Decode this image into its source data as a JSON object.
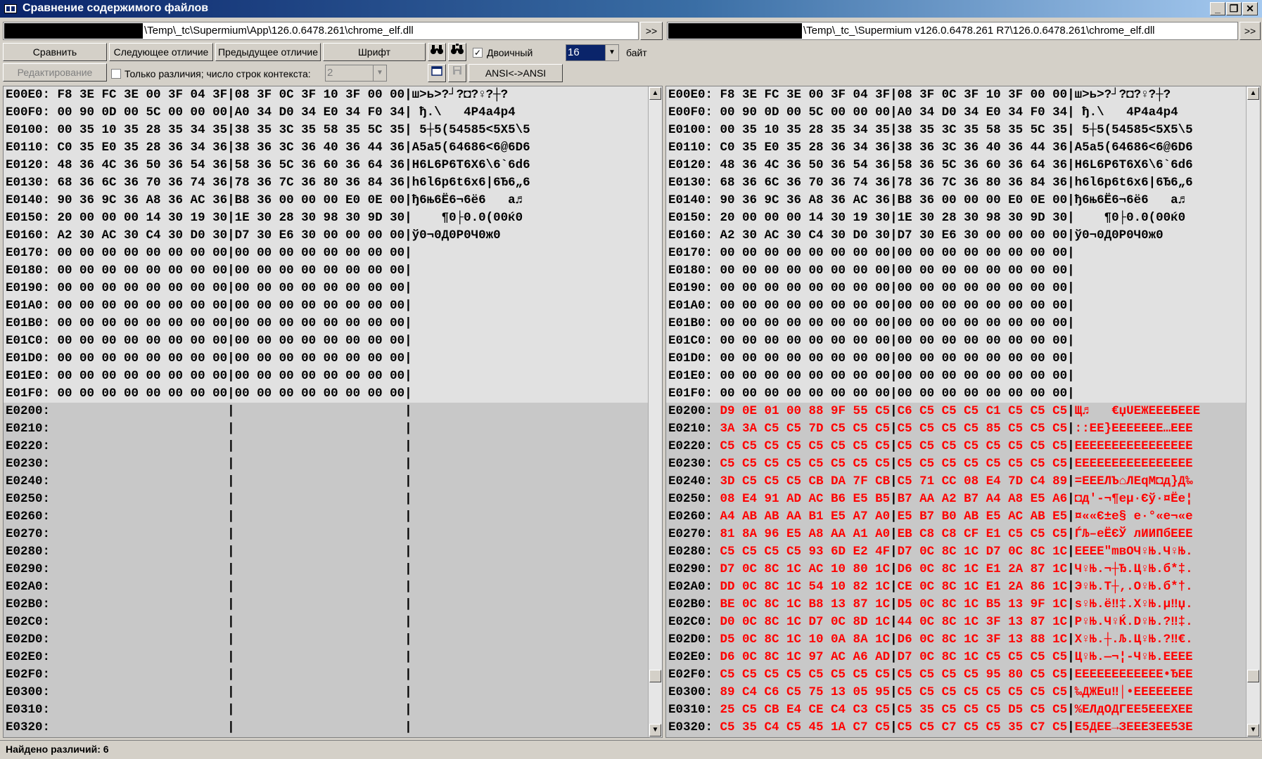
{
  "window": {
    "title": "Сравнение содержимого файлов"
  },
  "left_path": "\\Temp\\_tc\\Supermium\\App\\126.0.6478.261\\chrome_elf.dll",
  "right_path": "\\Temp\\_tc_\\Supermium v126.0.6478.261 R7\\126.0.6478.261\\chrome_elf.dll",
  "nav_label": ">>",
  "toolbar": {
    "compare": "Сравнить",
    "next_diff": "Следующее отличие",
    "prev_diff": "Предыдущее отличие",
    "font": "Шрифт",
    "binary_label": "Двоичный",
    "binary_checked": "✓",
    "bytes_value": "16",
    "bytes_label": "байт",
    "edit": "Редактирование",
    "only_diffs_label": "Только различия; число строк контекста:",
    "context_value": "2",
    "ansi": "ANSI<->ANSI"
  },
  "left_rows": [
    {
      "addr": "E00E0:",
      "hex1": "F8 3E FC 3E 00 3F 04 3F",
      "hex2": "08 3F 0C 3F 10 3F 00 00",
      "text": "ш>ь>?┘?◘?♀?┼?",
      "state": "same"
    },
    {
      "addr": "E00F0:",
      "hex1": "00 90 0D 00 5C 00 00 00",
      "hex2": "A0 34 D0 34 E0 34 F0 34",
      "text": " ђ.\\   4P4a4p4",
      "state": "same"
    },
    {
      "addr": "E0100:",
      "hex1": "00 35 10 35 28 35 34 35",
      "hex2": "38 35 3C 35 58 35 5C 35",
      "text": " 5┼5(54585<5X5\\5",
      "state": "same"
    },
    {
      "addr": "E0110:",
      "hex1": "C0 35 E0 35 28 36 34 36",
      "hex2": "38 36 3C 36 40 36 44 36",
      "text": "A5a5(64686<6@6D6",
      "state": "same"
    },
    {
      "addr": "E0120:",
      "hex1": "48 36 4C 36 50 36 54 36",
      "hex2": "58 36 5C 36 60 36 64 36",
      "text": "H6L6P6T6X6\\6`6d6",
      "state": "same"
    },
    {
      "addr": "E0130:",
      "hex1": "68 36 6C 36 70 36 74 36",
      "hex2": "78 36 7C 36 80 36 84 36",
      "text": "h6l6p6t6x6|6Ђ6„6",
      "state": "same"
    },
    {
      "addr": "E0140:",
      "hex1": "90 36 9C 36 A8 36 AC 36",
      "hex2": "B8 36 00 00 00 E0 0E 00",
      "text": "ђ6њ6Ё6¬6ё6   а♬",
      "state": "same"
    },
    {
      "addr": "E0150:",
      "hex1": "20 00 00 00 14 30 19 30",
      "hex2": "1E 30 28 30 98 30 9D 30",
      "text": "    ¶0├0.0(00ќ0",
      "state": "same"
    },
    {
      "addr": "E0160:",
      "hex1": "A2 30 AC 30 C4 30 D0 30",
      "hex2": "D7 30 E6 30 00 00 00 00",
      "text": "ў0¬0Д0Р0Ч0ж0",
      "state": "same"
    },
    {
      "addr": "E0170:",
      "hex1": "00 00 00 00 00 00 00 00",
      "hex2": "00 00 00 00 00 00 00 00",
      "text": "",
      "state": "same"
    },
    {
      "addr": "E0180:",
      "hex1": "00 00 00 00 00 00 00 00",
      "hex2": "00 00 00 00 00 00 00 00",
      "text": "",
      "state": "same"
    },
    {
      "addr": "E0190:",
      "hex1": "00 00 00 00 00 00 00 00",
      "hex2": "00 00 00 00 00 00 00 00",
      "text": "",
      "state": "same"
    },
    {
      "addr": "E01A0:",
      "hex1": "00 00 00 00 00 00 00 00",
      "hex2": "00 00 00 00 00 00 00 00",
      "text": "",
      "state": "same"
    },
    {
      "addr": "E01B0:",
      "hex1": "00 00 00 00 00 00 00 00",
      "hex2": "00 00 00 00 00 00 00 00",
      "text": "",
      "state": "same"
    },
    {
      "addr": "E01C0:",
      "hex1": "00 00 00 00 00 00 00 00",
      "hex2": "00 00 00 00 00 00 00 00",
      "text": "",
      "state": "same"
    },
    {
      "addr": "E01D0:",
      "hex1": "00 00 00 00 00 00 00 00",
      "hex2": "00 00 00 00 00 00 00 00",
      "text": "",
      "state": "same"
    },
    {
      "addr": "E01E0:",
      "hex1": "00 00 00 00 00 00 00 00",
      "hex2": "00 00 00 00 00 00 00 00",
      "text": "",
      "state": "same"
    },
    {
      "addr": "E01F0:",
      "hex1": "00 00 00 00 00 00 00 00",
      "hex2": "00 00 00 00 00 00 00 00",
      "text": "",
      "state": "same"
    },
    {
      "addr": "E0200:",
      "hex1": "",
      "hex2": "",
      "text": "",
      "state": "blank"
    },
    {
      "addr": "E0210:",
      "hex1": "",
      "hex2": "",
      "text": "",
      "state": "blank"
    },
    {
      "addr": "E0220:",
      "hex1": "",
      "hex2": "",
      "text": "",
      "state": "blank"
    },
    {
      "addr": "E0230:",
      "hex1": "",
      "hex2": "",
      "text": "",
      "state": "blank"
    },
    {
      "addr": "E0240:",
      "hex1": "",
      "hex2": "",
      "text": "",
      "state": "blank"
    },
    {
      "addr": "E0250:",
      "hex1": "",
      "hex2": "",
      "text": "",
      "state": "blank"
    },
    {
      "addr": "E0260:",
      "hex1": "",
      "hex2": "",
      "text": "",
      "state": "blank"
    },
    {
      "addr": "E0270:",
      "hex1": "",
      "hex2": "",
      "text": "",
      "state": "blank"
    },
    {
      "addr": "E0280:",
      "hex1": "",
      "hex2": "",
      "text": "",
      "state": "blank"
    },
    {
      "addr": "E0290:",
      "hex1": "",
      "hex2": "",
      "text": "",
      "state": "blank"
    },
    {
      "addr": "E02A0:",
      "hex1": "",
      "hex2": "",
      "text": "",
      "state": "blank"
    },
    {
      "addr": "E02B0:",
      "hex1": "",
      "hex2": "",
      "text": "",
      "state": "blank"
    },
    {
      "addr": "E02C0:",
      "hex1": "",
      "hex2": "",
      "text": "",
      "state": "blank"
    },
    {
      "addr": "E02D0:",
      "hex1": "",
      "hex2": "",
      "text": "",
      "state": "blank"
    },
    {
      "addr": "E02E0:",
      "hex1": "",
      "hex2": "",
      "text": "",
      "state": "blank"
    },
    {
      "addr": "E02F0:",
      "hex1": "",
      "hex2": "",
      "text": "",
      "state": "blank"
    },
    {
      "addr": "E0300:",
      "hex1": "",
      "hex2": "",
      "text": "",
      "state": "blank"
    },
    {
      "addr": "E0310:",
      "hex1": "",
      "hex2": "",
      "text": "",
      "state": "blank"
    },
    {
      "addr": "E0320:",
      "hex1": "",
      "hex2": "",
      "text": "",
      "state": "blank"
    }
  ],
  "right_rows": [
    {
      "addr": "E00E0:",
      "hex1": "F8 3E FC 3E 00 3F 04 3F",
      "hex2": "08 3F 0C 3F 10 3F 00 00",
      "text": "ш>ь>?┘?◘?♀?┼?",
      "state": "same"
    },
    {
      "addr": "E00F0:",
      "hex1": "00 90 0D 00 5C 00 00 00",
      "hex2": "A0 34 D0 34 E0 34 F0 34",
      "text": " ђ.\\   4P4a4p4",
      "state": "same"
    },
    {
      "addr": "E0100:",
      "hex1": "00 35 10 35 28 35 34 35",
      "hex2": "38 35 3C 35 58 35 5C 35",
      "text": " 5┼5(54585<5X5\\5",
      "state": "same"
    },
    {
      "addr": "E0110:",
      "hex1": "C0 35 E0 35 28 36 34 36",
      "hex2": "38 36 3C 36 40 36 44 36",
      "text": "A5a5(64686<6@6D6",
      "state": "same"
    },
    {
      "addr": "E0120:",
      "hex1": "48 36 4C 36 50 36 54 36",
      "hex2": "58 36 5C 36 60 36 64 36",
      "text": "H6L6P6T6X6\\6`6d6",
      "state": "same"
    },
    {
      "addr": "E0130:",
      "hex1": "68 36 6C 36 70 36 74 36",
      "hex2": "78 36 7C 36 80 36 84 36",
      "text": "h6l6p6t6x6|6Ђ6„6",
      "state": "same"
    },
    {
      "addr": "E0140:",
      "hex1": "90 36 9C 36 A8 36 AC 36",
      "hex2": "B8 36 00 00 00 E0 0E 00",
      "text": "ђ6њ6Ё6¬6ё6   а♬",
      "state": "same"
    },
    {
      "addr": "E0150:",
      "hex1": "20 00 00 00 14 30 19 30",
      "hex2": "1E 30 28 30 98 30 9D 30",
      "text": "    ¶0├0.0(00ќ0",
      "state": "same"
    },
    {
      "addr": "E0160:",
      "hex1": "A2 30 AC 30 C4 30 D0 30",
      "hex2": "D7 30 E6 30 00 00 00 00",
      "text": "ў0¬0Д0Р0Ч0ж0",
      "state": "same"
    },
    {
      "addr": "E0170:",
      "hex1": "00 00 00 00 00 00 00 00",
      "hex2": "00 00 00 00 00 00 00 00",
      "text": "",
      "state": "same"
    },
    {
      "addr": "E0180:",
      "hex1": "00 00 00 00 00 00 00 00",
      "hex2": "00 00 00 00 00 00 00 00",
      "text": "",
      "state": "same"
    },
    {
      "addr": "E0190:",
      "hex1": "00 00 00 00 00 00 00 00",
      "hex2": "00 00 00 00 00 00 00 00",
      "text": "",
      "state": "same"
    },
    {
      "addr": "E01A0:",
      "hex1": "00 00 00 00 00 00 00 00",
      "hex2": "00 00 00 00 00 00 00 00",
      "text": "",
      "state": "same"
    },
    {
      "addr": "E01B0:",
      "hex1": "00 00 00 00 00 00 00 00",
      "hex2": "00 00 00 00 00 00 00 00",
      "text": "",
      "state": "same"
    },
    {
      "addr": "E01C0:",
      "hex1": "00 00 00 00 00 00 00 00",
      "hex2": "00 00 00 00 00 00 00 00",
      "text": "",
      "state": "same"
    },
    {
      "addr": "E01D0:",
      "hex1": "00 00 00 00 00 00 00 00",
      "hex2": "00 00 00 00 00 00 00 00",
      "text": "",
      "state": "same"
    },
    {
      "addr": "E01E0:",
      "hex1": "00 00 00 00 00 00 00 00",
      "hex2": "00 00 00 00 00 00 00 00",
      "text": "",
      "state": "same"
    },
    {
      "addr": "E01F0:",
      "hex1": "00 00 00 00 00 00 00 00",
      "hex2": "00 00 00 00 00 00 00 00",
      "text": "",
      "state": "same"
    },
    {
      "addr": "E0200:",
      "hex1": "D9 0E 01 00 88 9F 55 C5",
      "hex2": "C6 C5 C5 C5 C1 C5 C5 C5",
      "text": "Щ♬   €џUЕЖЕЕЕБЕЕЕ",
      "state": "diff"
    },
    {
      "addr": "E0210:",
      "hex1": "3A 3A C5 C5 7D C5 C5 C5",
      "hex2": "C5 C5 C5 C5 85 C5 C5 C5",
      "text": "::ЕЕ}ЕЕЕЕЕЕЕ…ЕЕЕ",
      "state": "diff"
    },
    {
      "addr": "E0220:",
      "hex1": "C5 C5 C5 C5 C5 C5 C5 C5",
      "hex2": "C5 C5 C5 C5 C5 C5 C5 C5",
      "text": "ЕЕЕЕЕЕЕЕЕЕЕЕЕЕЕЕ",
      "state": "diff"
    },
    {
      "addr": "E0230:",
      "hex1": "C5 C5 C5 C5 C5 C5 C5 C5",
      "hex2": "C5 C5 C5 C5 C5 C5 C5 C5",
      "text": "ЕЕЕЕЕЕЕЕЕЕЕЕЕЕЕЕ",
      "state": "diff"
    },
    {
      "addr": "E0240:",
      "hex1": "3D C5 C5 C5 CB DA 7F CB",
      "hex2": "C5 71 CC 08 E4 7D C4 89",
      "text": "=ЕЕЕЛЪ⌂ЛЕqМ◘д}Д‰",
      "state": "diff"
    },
    {
      "addr": "E0250:",
      "hex1": "08 E4 91 AD AC B6 E5 B5",
      "hex2": "B7 AA A2 B7 A4 A8 E5 A6",
      "text": "◘д'-¬¶еµ·Єў·¤Ёе¦",
      "state": "diff"
    },
    {
      "addr": "E0260:",
      "hex1": "A4 AB AB AA B1 E5 A7 A0",
      "hex2": "E5 B7 B0 AB E5 AC AB E5",
      "text": "¤««Є±е§ е·°«е¬«е",
      "state": "diff"
    },
    {
      "addr": "E0270:",
      "hex1": "81 8A 96 E5 A8 AA A1 A0",
      "hex2": "EB C8 C8 CF E1 C5 C5 C5",
      "text": "ЃЉ–еЁЄЎ лИИПбЕЕЕ",
      "state": "diff"
    },
    {
      "addr": "E0280:",
      "hex1": "C5 C5 C5 C5 93 6D E2 4F",
      "hex2": "D7 0C 8C 1C D7 0C 8C 1C",
      "text": "ЕЕЕЕ\"mвOЧ♀Њ.Ч♀Њ.",
      "state": "diff"
    },
    {
      "addr": "E0290:",
      "hex1": "D7 0C 8C 1C AC 10 80 1C",
      "hex2": "D6 0C 8C 1C E1 2A 87 1C",
      "text": "Ч♀Њ.¬┼Ђ.Ц♀Њ.б*‡.",
      "state": "diff"
    },
    {
      "addr": "E02A0:",
      "hex1": "DD 0C 8C 1C 54 10 82 1C",
      "hex2": "CE 0C 8C 1C E1 2A 86 1C",
      "text": "Э♀Њ.T┼‚.О♀Њ.б*†.",
      "state": "diff"
    },
    {
      "addr": "E02B0:",
      "hex1": "BE 0C 8C 1C B8 13 87 1C",
      "hex2": "D5 0C 8C 1C B5 13 9F 1C",
      "text": "ѕ♀Њ.ё‼‡.Х♀Њ.µ‼џ.",
      "state": "diff"
    },
    {
      "addr": "E02C0:",
      "hex1": "D0 0C 8C 1C D7 0C 8D 1C",
      "hex2": "44 0C 8C 1C 3F 13 87 1C",
      "text": "Р♀Њ.Ч♀Ќ.D♀Њ.?‼‡.",
      "state": "diff"
    },
    {
      "addr": "E02D0:",
      "hex1": "D5 0C 8C 1C 10 0A 8A 1C",
      "hex2": "D6 0C 8C 1C 3F 13 88 1C",
      "text": "Х♀Њ.┼.Љ.Ц♀Њ.?‼€.",
      "state": "diff"
    },
    {
      "addr": "E02E0:",
      "hex1": "D6 0C 8C 1C 97 AC A6 AD",
      "hex2": "D7 0C 8C 1C C5 C5 C5 C5",
      "text": "Ц♀Њ.—¬¦-Ч♀Њ.ЕЕЕЕ",
      "state": "diff"
    },
    {
      "addr": "E02F0:",
      "hex1": "C5 C5 C5 C5 C5 C5 C5 C5",
      "hex2": "C5 C5 C5 C5 95 80 C5 C5",
      "text": "ЕЕЕЕЕЕЕЕЕЕЕЕ•ЂЕЕ",
      "state": "diff"
    },
    {
      "addr": "E0300:",
      "hex1": "89 C4 C6 C5 75 13 05 95",
      "hex2": "C5 C5 C5 C5 C5 C5 C5 C5",
      "text": "‰ДЖЕu‼│•ЕЕЕЕЕЕЕЕ",
      "state": "diff"
    },
    {
      "addr": "E0310:",
      "hex1": "25 C5 CB E4 CE C4 C3 C5",
      "hex2": "C5 35 C5 C5 C5 D5 C5 C5",
      "text": "%ЕЛдОДГЕЕ5ЕЕЕХЕЕ",
      "state": "diff"
    },
    {
      "addr": "E0320:",
      "hex1": "C5 35 C4 C5 45 1A C7 C5",
      "hex2": "C5 C5 C7 C5 C5 35 C7 C5",
      "text": "Е5ДЕЕ→ЗЕЕЕЗЕЕ5ЗЕ",
      "state": "diff"
    }
  ],
  "status": {
    "text": "Найдено различий: 6"
  }
}
